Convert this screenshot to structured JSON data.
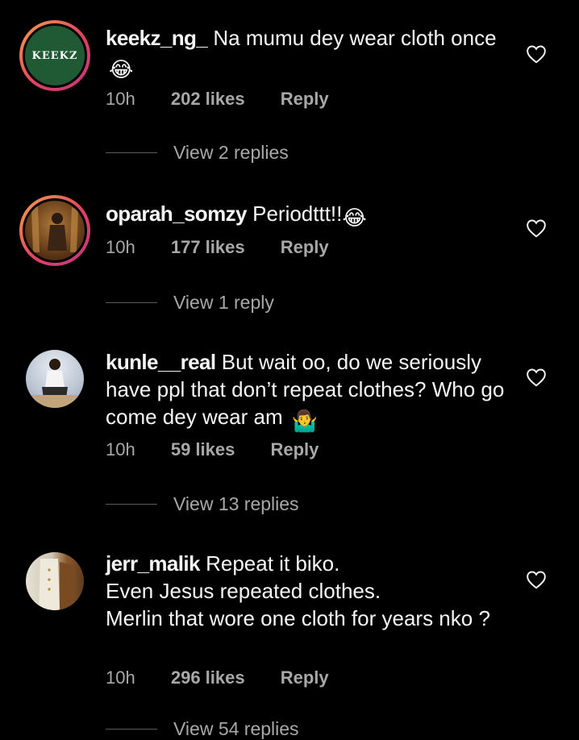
{
  "comments": [
    {
      "username": "keekz_ng_",
      "text": "Na mumu dey wear cloth once",
      "emoji": "😂",
      "time": "10h",
      "likes": "202 likes",
      "reply": "Reply",
      "view_replies": "View 2 replies",
      "avatar_text": "KEEKZ"
    },
    {
      "username": "oparah_somzy",
      "text": "Periodttt!!",
      "emoji": "😂",
      "time": "10h",
      "likes": "177 likes",
      "reply": "Reply",
      "view_replies": "View 1 reply"
    },
    {
      "username": "kunle__real",
      "text": "But wait oo, do we seriously have ppl that don’t repeat clothes? Who go come dey wear am",
      "emoji": "🤷‍♂️",
      "time": "10h",
      "likes": "59 likes",
      "reply": "Reply",
      "view_replies": "View 13 replies"
    },
    {
      "username": "jerr_malik",
      "text": "Repeat it biko.",
      "text_line2": "Even Jesus repeated clothes.",
      "text_line3": "Merlin that wore one cloth for years nko ?",
      "time": "10h",
      "likes": "296 likes",
      "reply": "Reply",
      "view_replies": "View 54 replies"
    }
  ],
  "colors": {
    "background": "#000000",
    "text": "#f5f5f5",
    "muted": "#a8a8a8",
    "keekz_avatar": "#1f5a35"
  },
  "icons": [
    "heart-icon"
  ]
}
